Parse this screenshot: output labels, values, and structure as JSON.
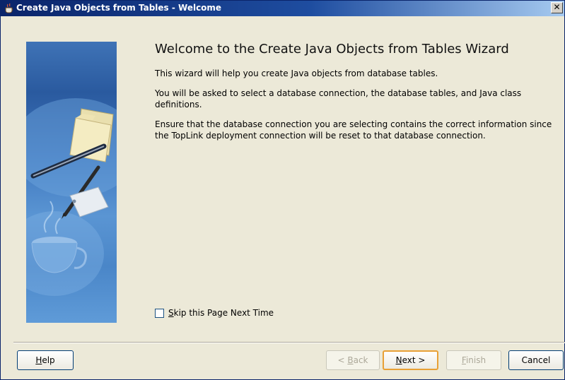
{
  "window": {
    "title": "Create Java Objects from Tables - Welcome",
    "close_glyph": "✕"
  },
  "content": {
    "heading": "Welcome to the Create Java Objects from Tables Wizard",
    "paragraphs": [
      "This wizard will help you create Java objects from database tables.",
      "You will be asked to select a database connection, the database tables, and Java class definitions.",
      "Ensure that the database connection you are selecting contains the correct information since the TopLink deployment connection will be reset to that database connection."
    ]
  },
  "skip_checkbox": {
    "label_mnemonic": "S",
    "label_rest": "kip this Page Next Time",
    "checked": false
  },
  "buttons": {
    "help": {
      "mnemonic": "H",
      "rest": "elp"
    },
    "back": {
      "prefix": "< ",
      "mnemonic": "B",
      "rest": "ack",
      "enabled": false
    },
    "next": {
      "mnemonic": "N",
      "rest": "ext >",
      "enabled": true
    },
    "finish": {
      "mnemonic": "F",
      "rest": "inish",
      "enabled": false
    },
    "cancel": {
      "label": "Cancel"
    }
  },
  "colors": {
    "titlebar_start": "#0a246a",
    "titlebar_end": "#a6caf0",
    "dialog_background": "#ece9d8",
    "default_button_highlight": "#e8a035"
  }
}
